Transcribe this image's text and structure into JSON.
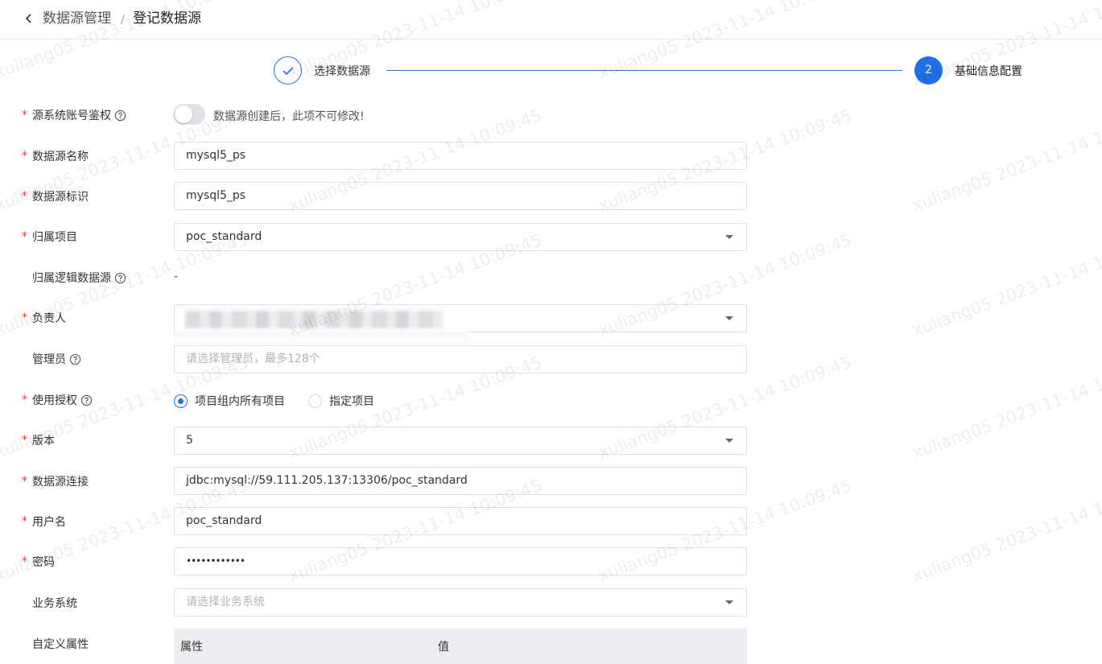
{
  "breadcrumb": {
    "parent": "数据源管理",
    "separator": "/",
    "current": "登记数据源"
  },
  "steps": [
    {
      "label": "选择数据源",
      "status": "done"
    },
    {
      "number": "2",
      "label": "基础信息配置",
      "status": "active"
    }
  ],
  "form": {
    "auth": {
      "label": "源系统账号鉴权",
      "note": "数据源创建后，此项不可修改!",
      "enabled": false
    },
    "name": {
      "label": "数据源名称",
      "value": "mysql5_ps"
    },
    "identifier": {
      "label": "数据源标识",
      "value": "mysql5_ps"
    },
    "project": {
      "label": "归属项目",
      "value": "poc_standard"
    },
    "logical": {
      "label": "归属逻辑数据源",
      "value": "-"
    },
    "owner": {
      "label": "负责人"
    },
    "admin": {
      "label": "管理员",
      "placeholder": "请选择管理员，最多128个"
    },
    "usage": {
      "label": "使用授权",
      "options": [
        "项目组内所有项目",
        "指定项目"
      ],
      "selected": "项目组内所有项目"
    },
    "version": {
      "label": "版本",
      "value": "5"
    },
    "connection": {
      "label": "数据源连接",
      "value": "jdbc:mysql://59.111.205.137:13306/poc_standard"
    },
    "username": {
      "label": "用户名",
      "value": "poc_standard"
    },
    "password": {
      "label": "密码",
      "value": "••••••••••••"
    },
    "biz_system": {
      "label": "业务系统",
      "placeholder": "请选择业务系统"
    },
    "custom_attrs": {
      "label": "自定义属性",
      "columns": [
        "属性",
        "值"
      ]
    }
  },
  "watermark": "xuliang05 2023-11-14 10:09:45",
  "colors": {
    "primary": "#1f6fe8",
    "required": "#e43a3a",
    "border": "#dcdfe6"
  }
}
